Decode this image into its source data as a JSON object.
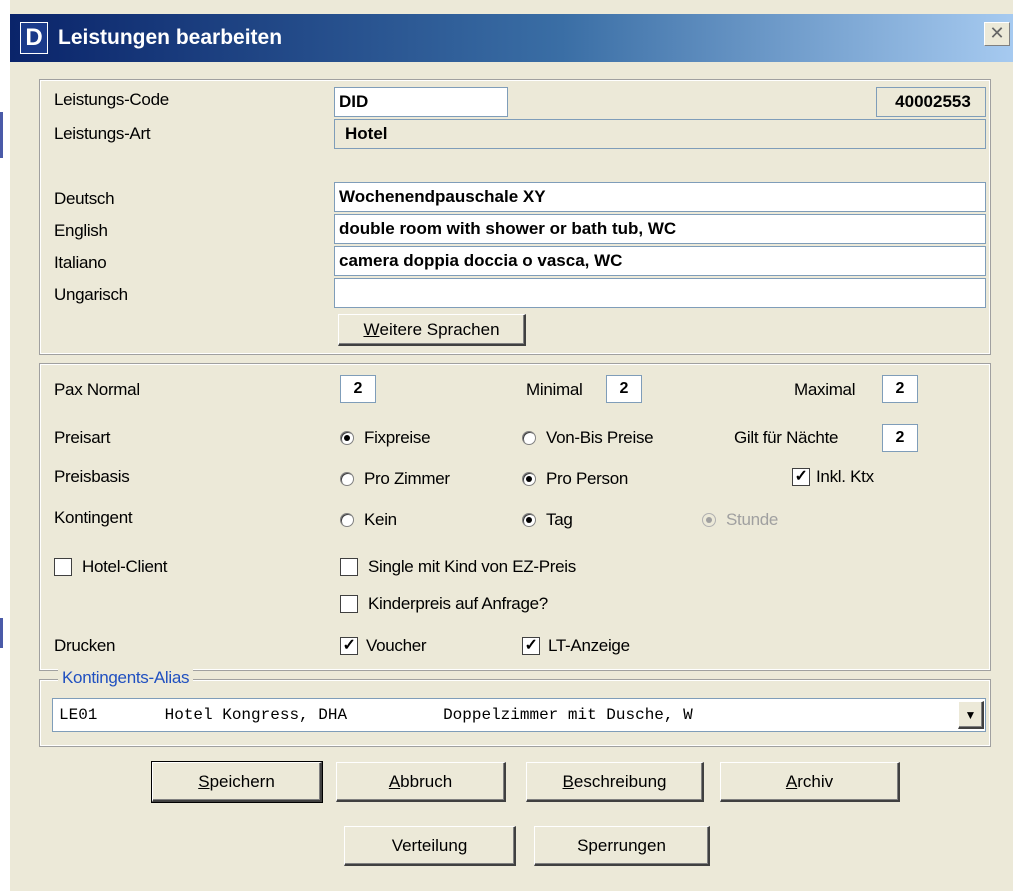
{
  "window": {
    "title": "Leistungen bearbeiten",
    "icon_letter": "D",
    "close_glyph": "✕"
  },
  "header": {
    "code_label": "Leistungs-Code",
    "code_value": "DID",
    "id_value": "40002553",
    "art_label": "Leistungs-Art",
    "art_value": "Hotel"
  },
  "languages": [
    {
      "label": "Deutsch",
      "value": "Wochenendpauschale XY"
    },
    {
      "label": "English",
      "value": "double room with shower or bath tub, WC"
    },
    {
      "label": "Italiano",
      "value": "camera doppia doccia o vasca, WC"
    },
    {
      "label": "Ungarisch",
      "value": ""
    }
  ],
  "more_languages_button": {
    "mnemonic": "W",
    "rest": "eitere Sprachen"
  },
  "pax": {
    "normal_label": "Pax Normal",
    "normal_value": "2",
    "min_label": "Minimal",
    "min_value": "2",
    "max_label": "Maximal",
    "max_value": "2"
  },
  "preisart": {
    "label": "Preisart",
    "options": [
      {
        "label": "Fixpreise",
        "selected": true
      },
      {
        "label": "Von-Bis Preise",
        "selected": false
      }
    ],
    "nights_label": "Gilt für Nächte",
    "nights_value": "2"
  },
  "preisbasis": {
    "label": "Preisbasis",
    "options": [
      {
        "label": "Pro Zimmer",
        "selected": false
      },
      {
        "label": "Pro Person",
        "selected": true
      }
    ],
    "ktx_label": "Inkl. Ktx",
    "ktx_checked": true
  },
  "kontingent": {
    "label": "Kontingent",
    "options": [
      {
        "label": "Kein",
        "selected": false,
        "disabled": false
      },
      {
        "label": "Tag",
        "selected": true,
        "disabled": false
      },
      {
        "label": "Stunde",
        "selected": true,
        "disabled": true
      }
    ]
  },
  "flags": {
    "hotel_client": {
      "label": "Hotel-Client",
      "checked": false
    },
    "single_child": {
      "label": "Single mit Kind von EZ-Preis",
      "checked": false
    },
    "child_price": {
      "label": "Kinderpreis auf Anfrage?",
      "checked": false
    }
  },
  "drucken": {
    "label": "Drucken",
    "voucher": {
      "label": "Voucher",
      "checked": true
    },
    "lt": {
      "label": "LT-Anzeige",
      "checked": true
    }
  },
  "alias": {
    "caption": "Kontingents-Alias",
    "selected": "LE01       Hotel Kongress, DHA          Doppelzimmer mit Dusche, W"
  },
  "buttons": {
    "save": {
      "mnemonic": "S",
      "rest": "peichern"
    },
    "cancel": {
      "mnemonic": "A",
      "rest": "bbruch"
    },
    "description": {
      "mnemonic": "B",
      "rest": "eschreibung"
    },
    "archive": {
      "mnemonic": "A",
      "rest": "rchiv"
    },
    "distribution": "Verteilung",
    "locks": "Sperrungen"
  },
  "colors": {
    "title_start": "#0a246a",
    "title_end": "#a6caf0",
    "dialog_bg": "#ece9d8",
    "group_caption": "#2050c0"
  }
}
